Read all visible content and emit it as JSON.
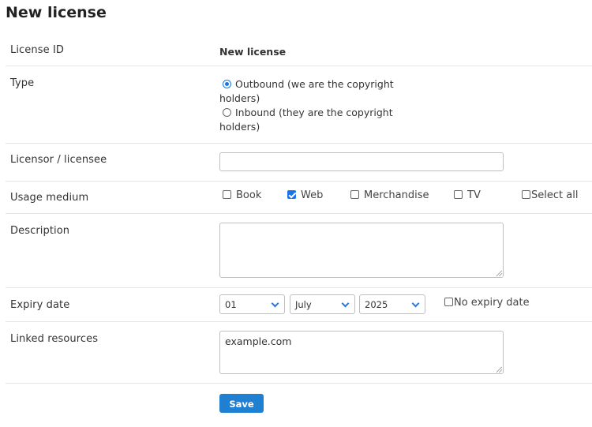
{
  "page": {
    "title": "New license"
  },
  "form": {
    "license_id": {
      "label": "License ID",
      "value": "New license"
    },
    "type": {
      "label": "Type",
      "options": [
        {
          "line1": "Outbound (we are the copyright",
          "line2": "holders)",
          "checked": true
        },
        {
          "line1": "Inbound (they are the copyright",
          "line2": "holders)",
          "checked": false
        }
      ]
    },
    "licensor": {
      "label": "Licensor / licensee",
      "value": ""
    },
    "usage_medium": {
      "label": "Usage medium",
      "options": [
        {
          "label": "Book",
          "checked": false
        },
        {
          "label": "Web",
          "checked": true
        },
        {
          "label": "Merchandise",
          "checked": false
        },
        {
          "label": "TV",
          "checked": false
        },
        {
          "label": "Select all",
          "checked": false
        }
      ]
    },
    "description": {
      "label": "Description",
      "value": ""
    },
    "expiry_date": {
      "label": "Expiry date",
      "day": "01",
      "month": "July",
      "year": "2025",
      "no_expiry_label": "No expiry date",
      "no_expiry_checked": false
    },
    "linked_resources": {
      "label": "Linked resources",
      "value": "example.com"
    },
    "save_label": "Save"
  },
  "colors": {
    "accent": "#1f7fd0",
    "checkbox_accent": "#1a73e8",
    "row_border": "#e6e6e6"
  }
}
